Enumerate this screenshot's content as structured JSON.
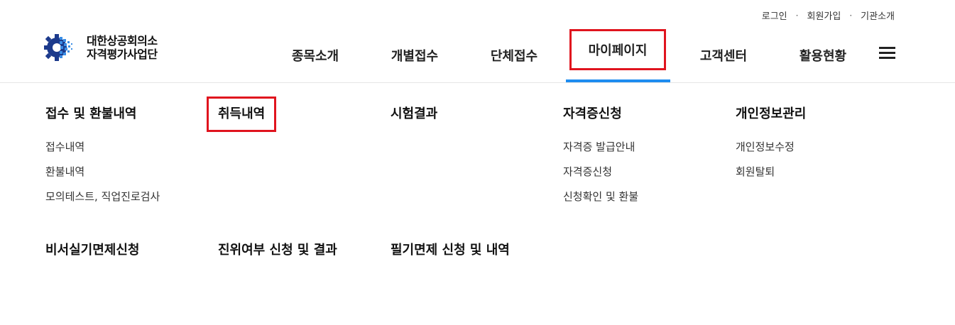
{
  "utility": {
    "login": "로그인",
    "signup": "회원가입",
    "about": "기관소개",
    "separator": "·"
  },
  "logo": {
    "line1": "대한상공회의소",
    "line2": "자격평가사업단",
    "icon": "gear-logo-icon",
    "brand_color": "#1c3a8c"
  },
  "gnb": {
    "items": [
      {
        "label": "종목소개"
      },
      {
        "label": "개별접수"
      },
      {
        "label": "단체접수"
      },
      {
        "label": "마이페이지"
      },
      {
        "label": "고객센터"
      },
      {
        "label": "활용현황"
      }
    ],
    "menu_icon": "hamburger-menu-icon",
    "active_index": 3,
    "active_color": "#1e8cf0",
    "highlight_color": "#e0141e"
  },
  "mega_menu": {
    "columns": [
      {
        "title": "접수 및 환불내역",
        "items": [
          "접수내역",
          "환불내역",
          "모의테스트, 직업진로검사"
        ]
      },
      {
        "title": "취득내역",
        "items": []
      },
      {
        "title": "시험결과",
        "items": []
      },
      {
        "title": "자격증신청",
        "items": [
          "자격증 발급안내",
          "자격증신청",
          "신청확인 및 환불"
        ]
      },
      {
        "title": "개인정보관리",
        "items": [
          "개인정보수정",
          "회원탈퇴"
        ]
      }
    ],
    "row2": [
      {
        "title": "비서실기면제신청"
      },
      {
        "title": "진위여부 신청 및 결과"
      },
      {
        "title": "필기면제 신청 및 내역"
      }
    ]
  }
}
